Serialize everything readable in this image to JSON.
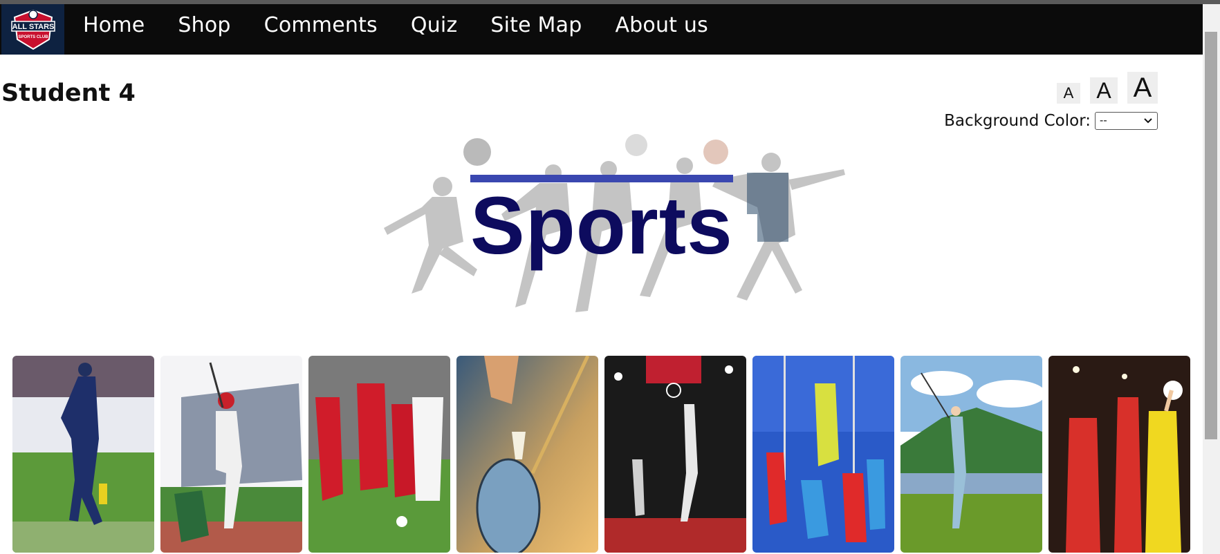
{
  "nav": {
    "logo_text": [
      "ALL STARS",
      "SPORTS CLUB"
    ],
    "items": [
      {
        "label": "Home"
      },
      {
        "label": "Shop"
      },
      {
        "label": "Comments"
      },
      {
        "label": "Quiz"
      },
      {
        "label": "Site Map"
      },
      {
        "label": "About us"
      }
    ]
  },
  "page": {
    "title": "Student 4"
  },
  "font_size_controls": {
    "small": "A",
    "medium": "A",
    "large": "A"
  },
  "background_color": {
    "label": "Background Color:",
    "selected": "--"
  },
  "hero": {
    "title": "Sports"
  },
  "gallery": {
    "cards": [
      {
        "name": "cricket"
      },
      {
        "name": "baseball"
      },
      {
        "name": "football"
      },
      {
        "name": "badminton"
      },
      {
        "name": "basketball"
      },
      {
        "name": "hockey"
      },
      {
        "name": "golf"
      },
      {
        "name": "netball"
      }
    ]
  },
  "colors": {
    "navbar": "#0b0b0b",
    "hero_title": "#0d0b5e",
    "hero_bar": "#3a47b0"
  }
}
